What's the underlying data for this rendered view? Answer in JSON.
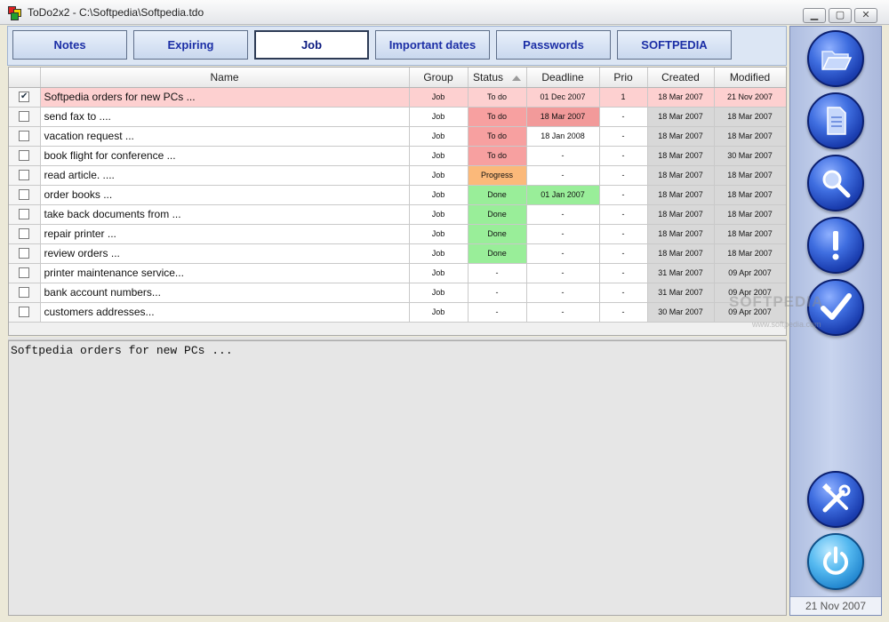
{
  "window": {
    "title": "ToDo2x2 - C:\\Softpedia\\Softpedia.tdo",
    "minimize": "▁",
    "maximize": "▢",
    "close": "✕"
  },
  "tabs": [
    {
      "label": "Notes",
      "active": false
    },
    {
      "label": "Expiring",
      "active": false
    },
    {
      "label": "Job",
      "active": true
    },
    {
      "label": "Important dates",
      "active": false
    },
    {
      "label": "Passwords",
      "active": false
    },
    {
      "label": "SOFTPEDIA",
      "active": false
    }
  ],
  "columns": {
    "name": "Name",
    "group": "Group",
    "status": "Status",
    "deadline": "Deadline",
    "prio": "Prio",
    "created": "Created",
    "modified": "Modified"
  },
  "tasks": [
    {
      "checked": true,
      "name": "Softpedia orders for new PCs ...",
      "group": "Job",
      "status": "To do",
      "deadline": "01 Dec 2007",
      "prio": "1",
      "created": "18 Mar 2007",
      "modified": "21 Nov 2007"
    },
    {
      "checked": false,
      "name": "send fax to ....",
      "group": "Job",
      "status": "To do",
      "deadline": "18 Mar 2007",
      "prio": "-",
      "created": "18 Mar 2007",
      "modified": "18 Mar 2007"
    },
    {
      "checked": false,
      "name": "vacation request ...",
      "group": "Job",
      "status": "To do",
      "deadline": "18 Jan 2008",
      "prio": "-",
      "created": "18 Mar 2007",
      "modified": "18 Mar 2007"
    },
    {
      "checked": false,
      "name": "book flight for conference ...",
      "group": "Job",
      "status": "To do",
      "deadline": "-",
      "prio": "-",
      "created": "18 Mar 2007",
      "modified": "30 Mar 2007"
    },
    {
      "checked": false,
      "name": "read article. ....",
      "group": "Job",
      "status": "Progress",
      "deadline": "-",
      "prio": "-",
      "created": "18 Mar 2007",
      "modified": "18 Mar 2007"
    },
    {
      "checked": false,
      "name": "order books ...",
      "group": "Job",
      "status": "Done",
      "deadline": "01 Jan 2007",
      "prio": "-",
      "created": "18 Mar 2007",
      "modified": "18 Mar 2007"
    },
    {
      "checked": false,
      "name": "take back documents from ...",
      "group": "Job",
      "status": "Done",
      "deadline": "-",
      "prio": "-",
      "created": "18 Mar 2007",
      "modified": "18 Mar 2007"
    },
    {
      "checked": false,
      "name": "repair printer ...",
      "group": "Job",
      "status": "Done",
      "deadline": "-",
      "prio": "-",
      "created": "18 Mar 2007",
      "modified": "18 Mar 2007"
    },
    {
      "checked": false,
      "name": "review orders ...",
      "group": "Job",
      "status": "Done",
      "deadline": "-",
      "prio": "-",
      "created": "18 Mar 2007",
      "modified": "18 Mar 2007"
    },
    {
      "checked": false,
      "name": "printer maintenance service...",
      "group": "Job",
      "status": "-",
      "deadline": "-",
      "prio": "-",
      "created": "31 Mar 2007",
      "modified": "09 Apr 2007"
    },
    {
      "checked": false,
      "name": "bank account numbers...",
      "group": "Job",
      "status": "-",
      "deadline": "-",
      "prio": "-",
      "created": "31 Mar 2007",
      "modified": "09 Apr 2007"
    },
    {
      "checked": false,
      "name": "customers addresses...",
      "group": "Job",
      "status": "-",
      "deadline": "-",
      "prio": "-",
      "created": "30 Mar 2007",
      "modified": "09 Apr 2007"
    }
  ],
  "note_text": "Softpedia orders for new PCs ...",
  "sidebar": {
    "buttons": [
      "folder-open-icon",
      "document-icon",
      "magnifier-icon",
      "exclamation-icon",
      "checkmark-icon",
      "tools-icon",
      "power-icon"
    ],
    "date": "21 Nov 2007"
  },
  "watermark": {
    "main": "SOFTPEDIA",
    "sub": "www.softpedia.com"
  },
  "colors": {
    "todo": "#f7a0a0",
    "progress": "#fbb97a",
    "done": "#99ee99",
    "selected_row": "#fdd0d0",
    "tab_text": "#1c2fa6"
  }
}
